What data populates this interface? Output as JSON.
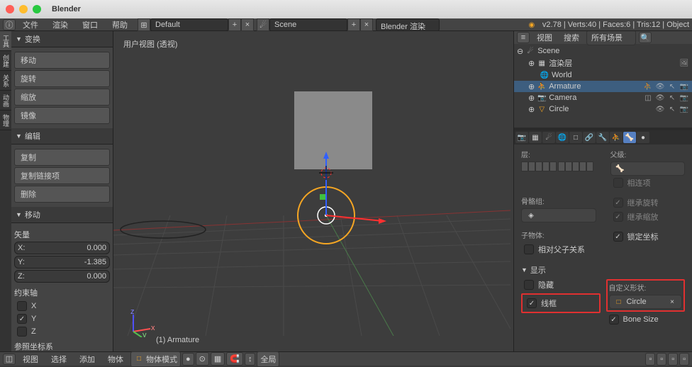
{
  "titlebar": {
    "app_name": "Blender"
  },
  "header": {
    "menus": [
      "文件",
      "渲染",
      "窗口",
      "帮助"
    ],
    "layout_value": "Default",
    "scene_value": "Scene",
    "engine": "Blender 渲染",
    "stats": "v2.78 | Verts:40 | Faces:6 | Tris:12 | Object"
  },
  "tool_tabs": [
    "工具",
    "创建",
    "关系",
    "动画",
    "物理"
  ],
  "panels": {
    "transform": {
      "title": "变换",
      "move": "移动",
      "rotate": "旋转",
      "scale": "缩放",
      "mirror": "镜像"
    },
    "edit": {
      "title": "编辑",
      "duplicate": "复制",
      "link_dup": "复制链接项",
      "delete": "删除"
    },
    "move": {
      "title": "移动",
      "vector": "矢量",
      "x_label": "X:",
      "x_val": "0.000",
      "y_label": "Y:",
      "y_val": "-1.385",
      "z_label": "Z:",
      "z_val": "0.000",
      "constraint": "约束轴",
      "cx": "X",
      "cy": "Y",
      "cz": "Z",
      "ref": "参照坐标系"
    }
  },
  "viewport": {
    "label": "用户视图 (透视)",
    "active_object": "(1) Armature"
  },
  "outliner": {
    "menus": [
      "视图",
      "搜索"
    ],
    "filter": "所有场景",
    "scene": "Scene",
    "render_layers": "渲染层",
    "world": "World",
    "armature": "Armature",
    "camera": "Camera",
    "circle": "Circle"
  },
  "props": {
    "layer_label": "层:",
    "parent_label": "父级:",
    "relative_parent": "相连项",
    "bone_group_label": "骨骼组:",
    "inherit_rotation": "继承旋转",
    "inherit_scale": "继承缩放",
    "child_label": "子物体:",
    "lock_transform": "锁定坐标",
    "relative_child": "相对父子关系",
    "display_title": "显示",
    "hidden": "隐藏",
    "wireframe": "线框",
    "custom_shape_label": "自定义形状:",
    "custom_shape_value": "Circle",
    "bone_size": "Bone Size"
  },
  "footer": {
    "menus": [
      "视图",
      "选择",
      "添加",
      "物体"
    ],
    "mode": "物体模式",
    "orientation": "全局"
  },
  "colors": {
    "accent": "#5680c2",
    "highlight": "#e03030",
    "orange": "#f5a623"
  }
}
